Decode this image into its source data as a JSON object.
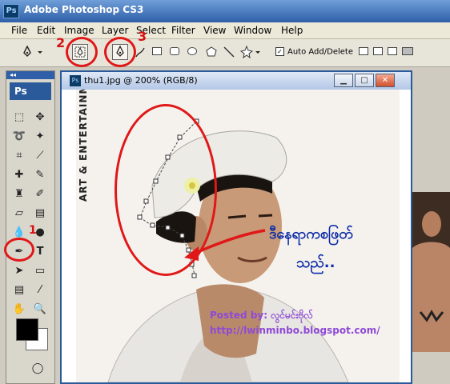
{
  "app": {
    "title": "Adobe Photoshop CS3",
    "icon": "Ps"
  },
  "menu": [
    "File",
    "Edit",
    "Image",
    "Layer",
    "Select",
    "Filter",
    "View",
    "Window",
    "Help"
  ],
  "options": {
    "auto_add_delete": "Auto Add/Delete",
    "auto_add_checked": true
  },
  "steps": [
    "2",
    "3",
    "1"
  ],
  "toolbox": {
    "badge": "Ps"
  },
  "document": {
    "title": "thu1.jpg @ 200% (RGB/8)",
    "icon": "Ps",
    "watermark": "ART & ENTERTAINMENT"
  },
  "annotation": {
    "line1": "ဒီနေရာကစဖြတ်",
    "line2": "သည်.."
  },
  "credit": {
    "posted": "Posted by: လွင်မင်းဗိုလ်",
    "url": "http://lwinminbo.blogspot.com/"
  },
  "colors": {
    "accent_red": "#e01818",
    "annotation_blue": "#0e2da8",
    "credit_purple": "#8e4ad6"
  }
}
